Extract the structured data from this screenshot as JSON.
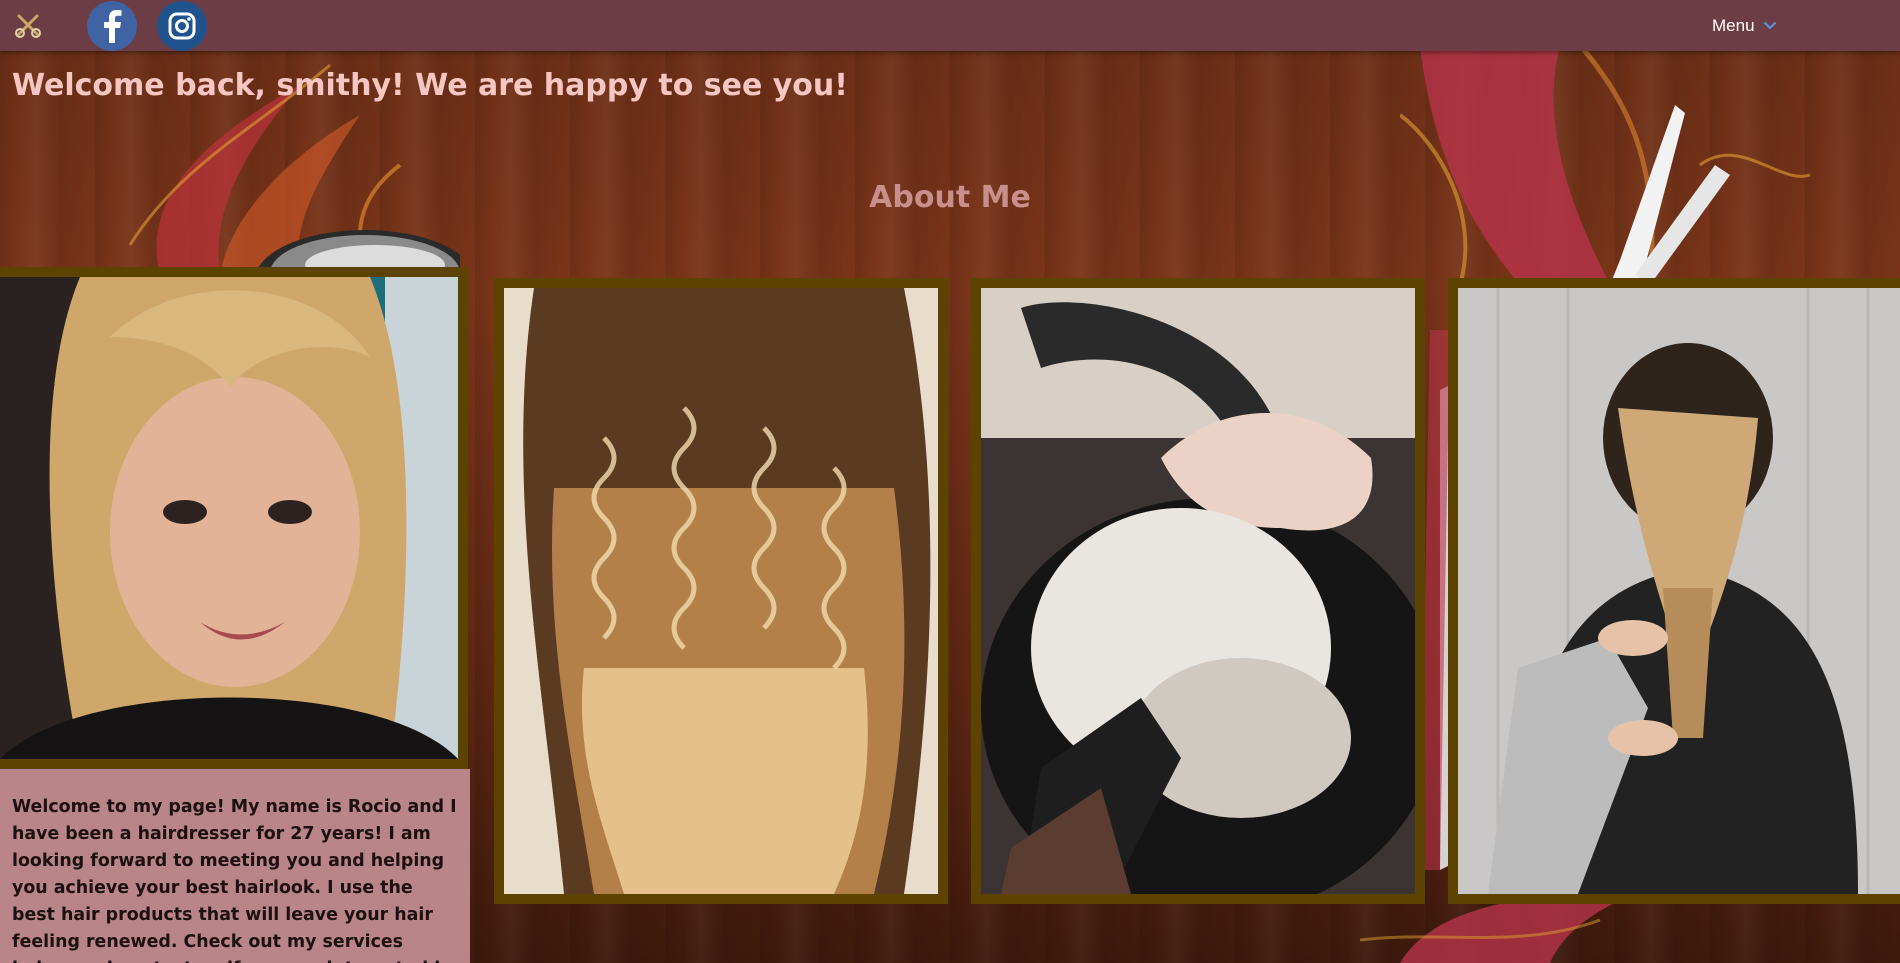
{
  "header": {
    "logo_icon": "scissors-logo-icon",
    "social": [
      {
        "name": "facebook",
        "icon": "facebook-icon",
        "color": "#3f63a3"
      },
      {
        "name": "instagram",
        "icon": "instagram-icon",
        "color": "#20528e"
      }
    ],
    "menu_label": "Menu",
    "menu_icon": "chevron-down-icon",
    "bar_color": "#6c3d44"
  },
  "main": {
    "welcome": "Welcome back, smithy! We are happy to see you!",
    "section_title": "About Me",
    "about_text": "Welcome to my page! My name is Rocio and I have been a hairdresser for 27 years! I am looking forward to meeting you and helping you achieve your best hairlook. I use the best hair products that will leave your hair feeling renewed. Check out my services below and contact us if you are interested in service.",
    "photos": [
      {
        "subject": "portrait of stylist"
      },
      {
        "subject": "blonde curls"
      },
      {
        "subject": "hair wash at salon sink"
      },
      {
        "subject": "braiding blonde hair"
      }
    ]
  },
  "colors": {
    "welcome_text": "#f6c6c2",
    "title_text": "#c88f8d",
    "card_frame": "#5c4400",
    "about_box": "#b98588"
  }
}
